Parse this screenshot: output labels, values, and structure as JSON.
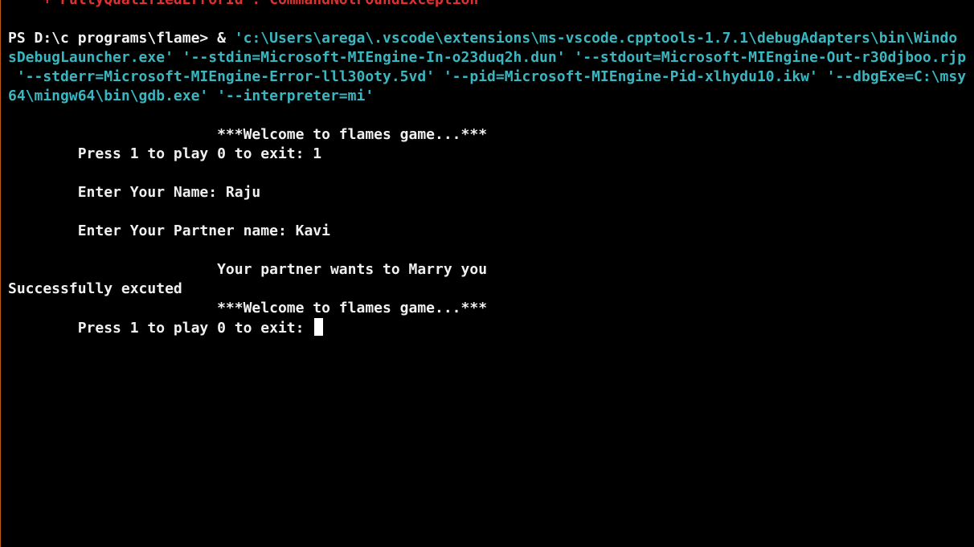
{
  "terminal": {
    "error_line": "    + FullyQualifiedErrorId : CommandNotFoundException",
    "prompt": "PS D:\\c programs\\flame>",
    "command_operator": " & ",
    "command_line_1": "'c:\\Users\\arega\\.vscode\\extensions\\ms-vscode.cpptools-1.7.1\\debugAdapters\\bin\\WindowsDebugLauncher.exe'",
    "command_line_1_visible": "'c:\\Users\\arega\\.vscode\\extensions\\ms-vscode.cpptools-1.7.1\\debugAdapters\\bin\\Windo",
    "command_line_2": "sDebugLauncher.exe' '--stdin=Microsoft-MIEngine-In-o23duq2h.dun' '--stdout=Microsoft-MIEngine-Out-r30djboo.rjp",
    "command_line_3": " '--stderr=Microsoft-MIEngine-Error-lll30oty.5vd' '--pid=Microsoft-MIEngine-Pid-xlhydu10.ikw' '--dbgExe=C:\\msy",
    "command_line_4": "64\\mingw64\\bin\\gdb.exe' '--interpreter=mi'",
    "output": [
      "                        ***Welcome to flames game...***",
      "        Press 1 to play 0 to exit: 1",
      "",
      "        Enter Your Name: Raju",
      "",
      "        Enter Your Partner name: Kavi",
      "",
      "                        Your partner wants to Marry you",
      "Successfully excuted",
      "                        ***Welcome to flames game...***",
      "        Press 1 to play 0 to exit: "
    ]
  }
}
